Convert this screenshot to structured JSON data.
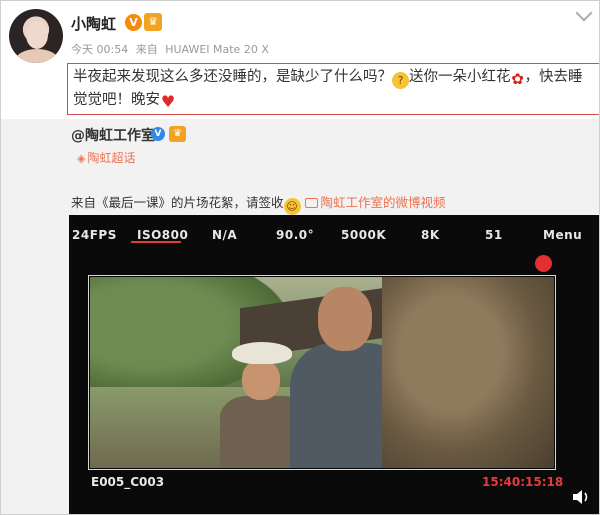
{
  "header": {
    "username": "小陶虹",
    "verified_icon": "verified-v-icon",
    "member_icon": "crown-icon",
    "time": "今天 00:54",
    "source_prefix": "来自",
    "source_device": "HUAWEI Mate 20 X"
  },
  "post": {
    "line1_a": "半夜起来发现这么多还没睡的，是缺少了什么吗？",
    "line1_b": "送你一朵小红花",
    "line1_c": "，快去睡",
    "line2_a": "觉觉吧！晚安"
  },
  "repost": {
    "origin_user": "@陶虹工作室",
    "supertopic_label": "陶虹超话",
    "text": "来自《最后一课》的片场花絮，请签收",
    "video_link_label": "陶虹工作室的微博视频"
  },
  "video": {
    "hud": {
      "fps": "24FPS",
      "iso": "ISO800",
      "na": "N/A",
      "shutter": "90.0°",
      "wb": "5000K",
      "res": "8K",
      "number": "51",
      "menu": "Menu"
    },
    "clip_id": "E005_C003",
    "timecode": "15:40:15:18"
  },
  "colors": {
    "accent_orange": "#eb7350",
    "highlight_border": "#d64b4b",
    "record_red": "#e0302f"
  }
}
